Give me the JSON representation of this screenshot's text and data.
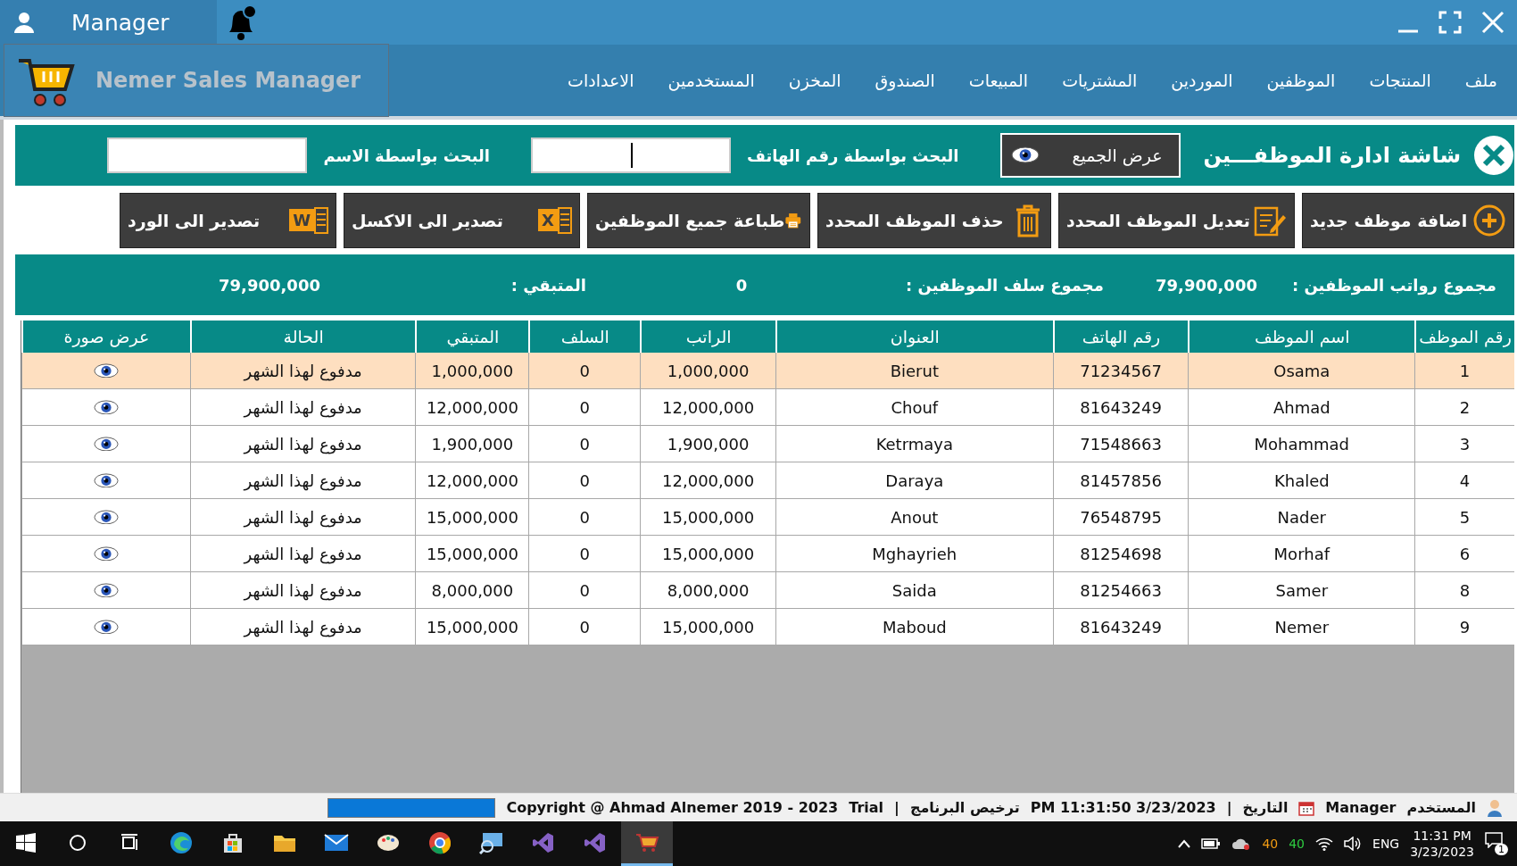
{
  "title_bar": {
    "user": "Manager"
  },
  "app": {
    "title": "Nemer Sales Manager"
  },
  "menu": [
    "ملف",
    "المنتجات",
    "الموظفين",
    "الموردين",
    "المشتريات",
    "المبيعات",
    "الصندوق",
    "المخزن",
    "المستخدمين",
    "الاعدادات"
  ],
  "screen": {
    "title": "شاشة ادارة الموظفـــين",
    "show_all": "عرض الجميع",
    "searches": [
      {
        "label": "البحث بواسطة رقم الهاتف",
        "focused": true
      },
      {
        "label": "البحث بواسطة الاسم",
        "focused": false
      }
    ]
  },
  "toolbar": [
    {
      "kind": "add",
      "label": "اضافة موظف جديد"
    },
    {
      "kind": "edit",
      "label": "تعديل الموظف المحدد"
    },
    {
      "kind": "delete",
      "label": "حذف الموظف المحدد"
    },
    {
      "kind": "print",
      "label": "طباعة جميع الموظفين"
    },
    {
      "kind": "excel",
      "label": "تصدير الى الاكسل",
      "icon_letter": "X"
    },
    {
      "kind": "word",
      "label": "تصدير الى الورد",
      "icon_letter": "W"
    }
  ],
  "totals": [
    {
      "label": "مجموع رواتب الموظفين :",
      "value": "79,900,000"
    },
    {
      "label": "مجموع سلف الموظفين :",
      "value": "0"
    },
    {
      "label": "المتبقي :",
      "value": "79,900,000"
    }
  ],
  "table": {
    "columns": [
      "رقم الموظف",
      "اسم الموظف",
      "رقم الهاتف",
      "العنوان",
      "الراتب",
      "السلف",
      "المتبقي",
      "الحالة",
      "عرض صورة"
    ],
    "rows": [
      {
        "id": "1",
        "name": "Osama",
        "phone": "71234567",
        "address": "Bierut",
        "salary": "1,000,000",
        "advance": "0",
        "remaining": "1,000,000",
        "status": "مدفوع لهذا الشهر",
        "selected": true
      },
      {
        "id": "2",
        "name": "Ahmad",
        "phone": "81643249",
        "address": "Chouf",
        "salary": "12,000,000",
        "advance": "0",
        "remaining": "12,000,000",
        "status": "مدفوع لهذا الشهر",
        "selected": false
      },
      {
        "id": "3",
        "name": "Mohammad",
        "phone": "71548663",
        "address": "Ketrmaya",
        "salary": "1,900,000",
        "advance": "0",
        "remaining": "1,900,000",
        "status": "مدفوع لهذا الشهر",
        "selected": false
      },
      {
        "id": "4",
        "name": "Khaled",
        "phone": "81457856",
        "address": "Daraya",
        "salary": "12,000,000",
        "advance": "0",
        "remaining": "12,000,000",
        "status": "مدفوع لهذا الشهر",
        "selected": false
      },
      {
        "id": "5",
        "name": "Nader",
        "phone": "76548795",
        "address": "Anout",
        "salary": "15,000,000",
        "advance": "0",
        "remaining": "15,000,000",
        "status": "مدفوع لهذا الشهر",
        "selected": false
      },
      {
        "id": "6",
        "name": "Morhaf",
        "phone": "81254698",
        "address": "Mghayrieh",
        "salary": "15,000,000",
        "advance": "0",
        "remaining": "15,000,000",
        "status": "مدفوع لهذا الشهر",
        "selected": false
      },
      {
        "id": "8",
        "name": "Samer",
        "phone": "81254663",
        "address": "Saida",
        "salary": "8,000,000",
        "advance": "0",
        "remaining": "8,000,000",
        "status": "مدفوع لهذا الشهر",
        "selected": false
      },
      {
        "id": "9",
        "name": "Nemer",
        "phone": "81643249",
        "address": "Maboud",
        "salary": "15,000,000",
        "advance": "0",
        "remaining": "15,000,000",
        "status": "مدفوع لهذا الشهر",
        "selected": false
      }
    ]
  },
  "status_bar": {
    "user_label": "المستخدم",
    "user": "Manager",
    "date_label": "التاريخ",
    "separator_1": "|",
    "datetime": "PM 11:31:50 3/23/2023",
    "license_label": "ترخيص البرنامج",
    "separator_2": "|",
    "license": "Trial",
    "copyright": "Copyright @ Ahmad Alnemer 2019 - 2023",
    "progress": {
      "level": 1
    }
  },
  "taskbar": {
    "apps": [
      {
        "kind": "edge",
        "selected": false
      },
      {
        "kind": "store",
        "selected": false
      },
      {
        "kind": "folder",
        "selected": false
      },
      {
        "kind": "mail",
        "selected": false
      },
      {
        "kind": "paint",
        "selected": false
      },
      {
        "kind": "chrome",
        "selected": false
      },
      {
        "kind": "monitor",
        "selected": false
      },
      {
        "kind": "studio",
        "selected": false
      },
      {
        "kind": "studio",
        "selected": false
      },
      {
        "kind": "cart",
        "selected": true
      }
    ],
    "tray": {
      "gpu_temp": "40",
      "cpu_temp": "40",
      "language": "ENG",
      "time": "11:31 PM",
      "date": "3/23/2023",
      "notifications": "1"
    }
  }
}
